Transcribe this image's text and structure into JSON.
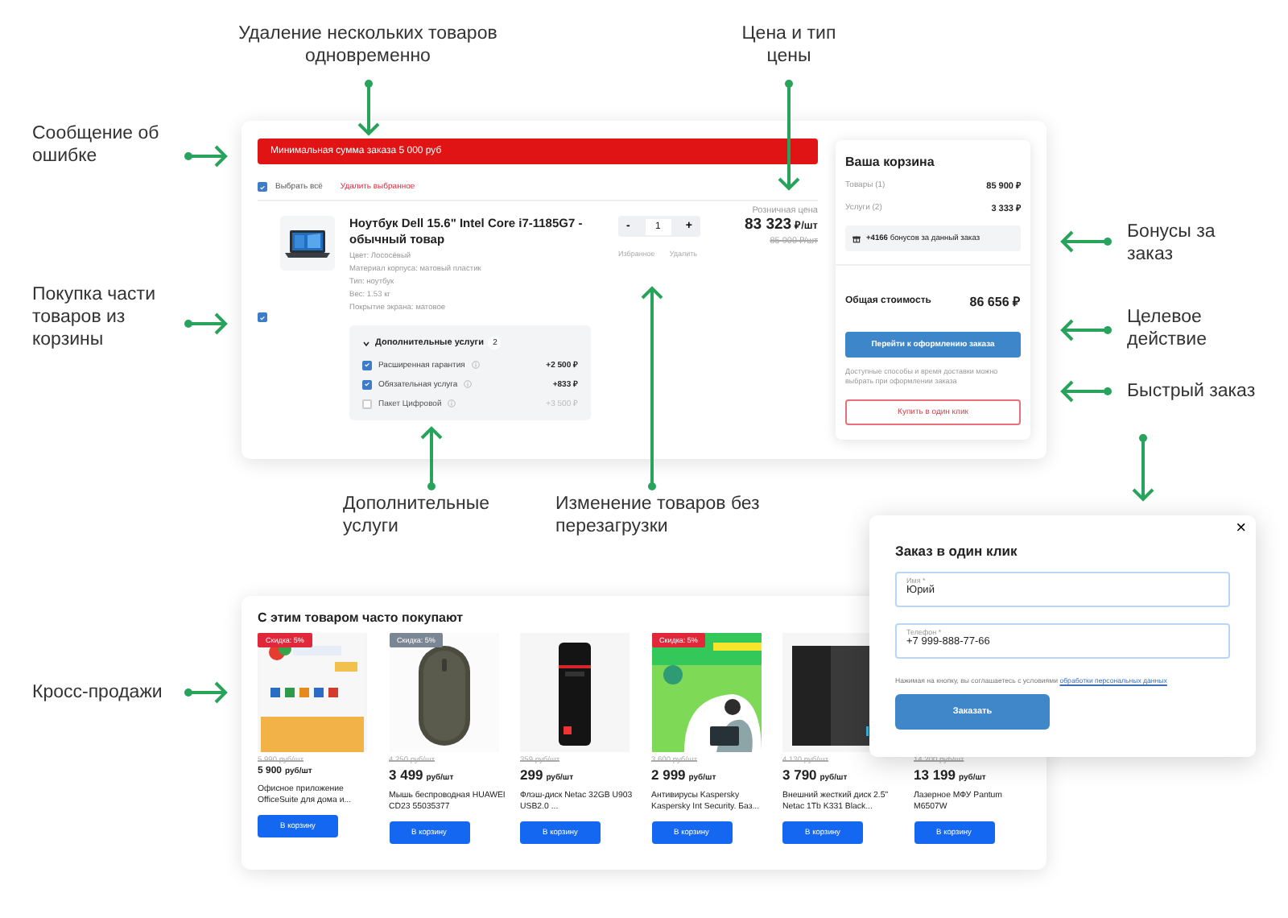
{
  "annotations": [
    {
      "text": "Удаление нескольких товаров одновременно"
    },
    {
      "text": "Цена и тип цены"
    },
    {
      "text": "Сообщение об ошибке"
    },
    {
      "text": "Бонусы за заказ"
    },
    {
      "text": "Покупка части товаров из корзины"
    },
    {
      "text": "Целевое действие"
    },
    {
      "text": "Быстрый заказ"
    },
    {
      "text": "Дополнительные услуги"
    },
    {
      "text": "Изменение товаров без перезагрузки"
    },
    {
      "text": "Кросс-продажи"
    }
  ],
  "cart": {
    "error": "Минимальная сумма заказа 5 000 руб",
    "select_all": {
      "label": "Выбрать всё",
      "checked": true
    },
    "delete_selected": "Удалить выбранное",
    "item": {
      "checked": true,
      "title": "Ноутбук Dell 15.6\" Intel Core i7-1185G7 - обычный товар",
      "props": [
        "Цвет: Лососёвый",
        "Материал корпуса: матовый пластик",
        "Тип: ноутбук",
        "Вес: 1.53 кг",
        "Покрытие экрана: матовое"
      ],
      "minus": "-",
      "quantity": "1",
      "plus": "+",
      "favorite": "Избранное",
      "remove": "Удалить",
      "price_label": "Розничная цена",
      "price": "83 323",
      "price_unit": "₽/шт",
      "old_price": "85 900 ₽/шт",
      "services": {
        "title": "Дополнительные услуги",
        "count": "2",
        "expanded": true,
        "items": [
          {
            "label": "Расширенная гарантия",
            "price": "+2 500 ₽",
            "checked": true
          },
          {
            "label": "Обязательная услуга",
            "price": "+833 ₽",
            "checked": true
          },
          {
            "label": "Пакет Цифровой",
            "price": "+3 500 ₽",
            "checked": false
          }
        ]
      }
    }
  },
  "summary": {
    "title": "Ваша корзина",
    "rows": [
      {
        "label": "Товары (1)",
        "value": "85 900 ₽"
      },
      {
        "label": "Услуги (2)",
        "value": "3 333 ₽"
      }
    ],
    "bonus": "**+4166** бонусов за данный заказ",
    "total_label": "Общая стоимость",
    "total": "86 656 ₽",
    "checkout": "Перейти к оформлению заказа",
    "note": "Доступные способы и время доставки можно выбрать при оформлении заказа",
    "one_click": "Купить в один клик"
  },
  "cross_sell": {
    "title": "С этим товаром часто покупают",
    "items": [
      {
        "badge": "Скидка: 5%",
        "color": "#e0283a",
        "picture": true,
        "old_price": "5 990 руб/шт",
        "price": "5 900",
        "unit": "руб/шт",
        "name": "Офисное приложение OfficeSuite для дома и...",
        "button": "В корзину"
      },
      {
        "badge": "Скидка: 5%",
        "color": "#7b8694",
        "picture": true,
        "old_price": "4 250 руб/шт",
        "price": "3 499",
        "unit": "руб/шт",
        "name": "Мышь беспроводная HUAWEI CD23 55035377",
        "button": "В корзину"
      },
      {
        "picture": true,
        "old_price": "359 руб/шт",
        "price": "299",
        "unit": "руб/шт",
        "name": "Флэш-диск Netac 32GB U903 USB2.0 ...",
        "button": "В корзину"
      },
      {
        "badge": "Скидка: 5%",
        "color": "#e0283a",
        "picture": true,
        "old_price": "3 600 руб/шт",
        "price": "2 999",
        "unit": "руб/шт",
        "name": "Антивирусы Kaspersky Kaspersky Int Security. Баз...",
        "button": "В корзину"
      },
      {
        "picture": true,
        "old_price": "4 130 руб/шт",
        "price": "3 790",
        "unit": "руб/шт",
        "name": "Внешний жесткий диск 2.5\" Netac 1Tb K331 Black...",
        "button": "В корзину"
      },
      {
        "picture": false,
        "old_price": "14 200 руб/шт",
        "price": "13 199",
        "unit": "руб/шт",
        "name": "Лазерное МФУ Pantum M6507W",
        "button": "В корзину"
      }
    ]
  },
  "popup": {
    "close": "×",
    "title": "Заказ в один клик",
    "fields": [
      {
        "label": "Имя *",
        "value": "Юрий"
      },
      {
        "label": "Телефон *",
        "value": "+7 999-888-77-66"
      }
    ],
    "consent": "Нажимая на кнопку, вы соглашаетесь с условиями",
    "consent_link": "обработки персональных данных",
    "submit": "Заказать"
  }
}
